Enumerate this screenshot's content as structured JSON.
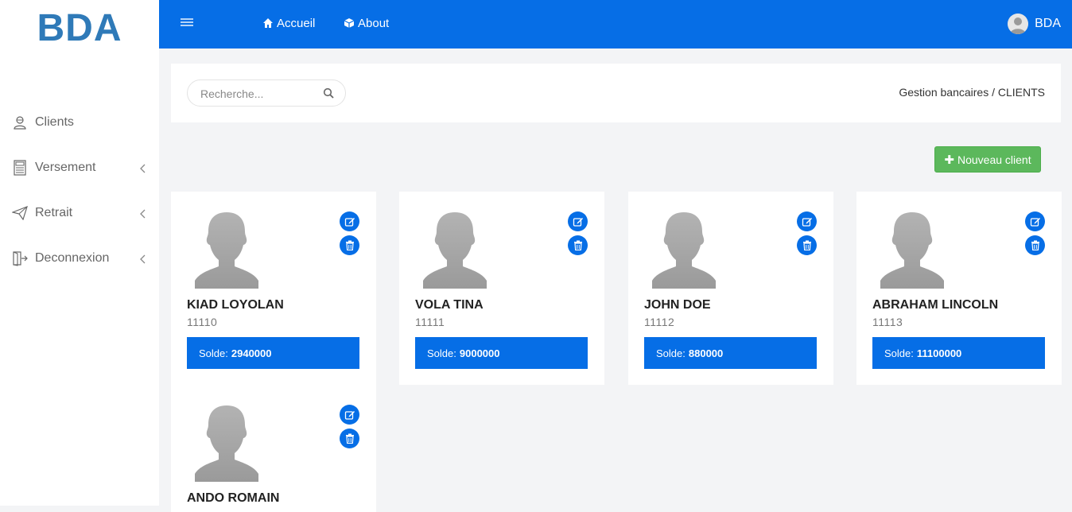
{
  "brand": "BDA",
  "sidebar": {
    "items": [
      {
        "label": "Clients",
        "icon": "user-icon",
        "has_chevron": false
      },
      {
        "label": "Versement",
        "icon": "calculator-icon",
        "has_chevron": true
      },
      {
        "label": "Retrait",
        "icon": "paper-plane-icon",
        "has_chevron": true
      },
      {
        "label": "Deconnexion",
        "icon": "door-exit-icon",
        "has_chevron": true
      }
    ]
  },
  "topbar": {
    "nav": [
      {
        "label": "Accueil",
        "icon": "home-icon"
      },
      {
        "label": "About",
        "icon": "cube-icon"
      }
    ],
    "user": "BDA"
  },
  "search": {
    "placeholder": "Recherche..."
  },
  "breadcrumb": "Gestion bancaires / CLIENTS",
  "new_client_button": "Nouveau client",
  "solde_label": "Solde:",
  "clients": [
    {
      "name": "KIAD LOYOLAN",
      "number": "11110",
      "solde": "2940000"
    },
    {
      "name": "VOLA TINA",
      "number": "11111",
      "solde": "9000000"
    },
    {
      "name": "JOHN DOE",
      "number": "11112",
      "solde": "880000"
    },
    {
      "name": "ABRAHAM LINCOLN",
      "number": "11113",
      "solde": "11100000"
    },
    {
      "name": "ANDO ROMAIN",
      "number": "",
      "solde": ""
    }
  ],
  "colors": {
    "primary": "#066ee6",
    "brand": "#2f7ab8",
    "success": "#5cb85c"
  }
}
